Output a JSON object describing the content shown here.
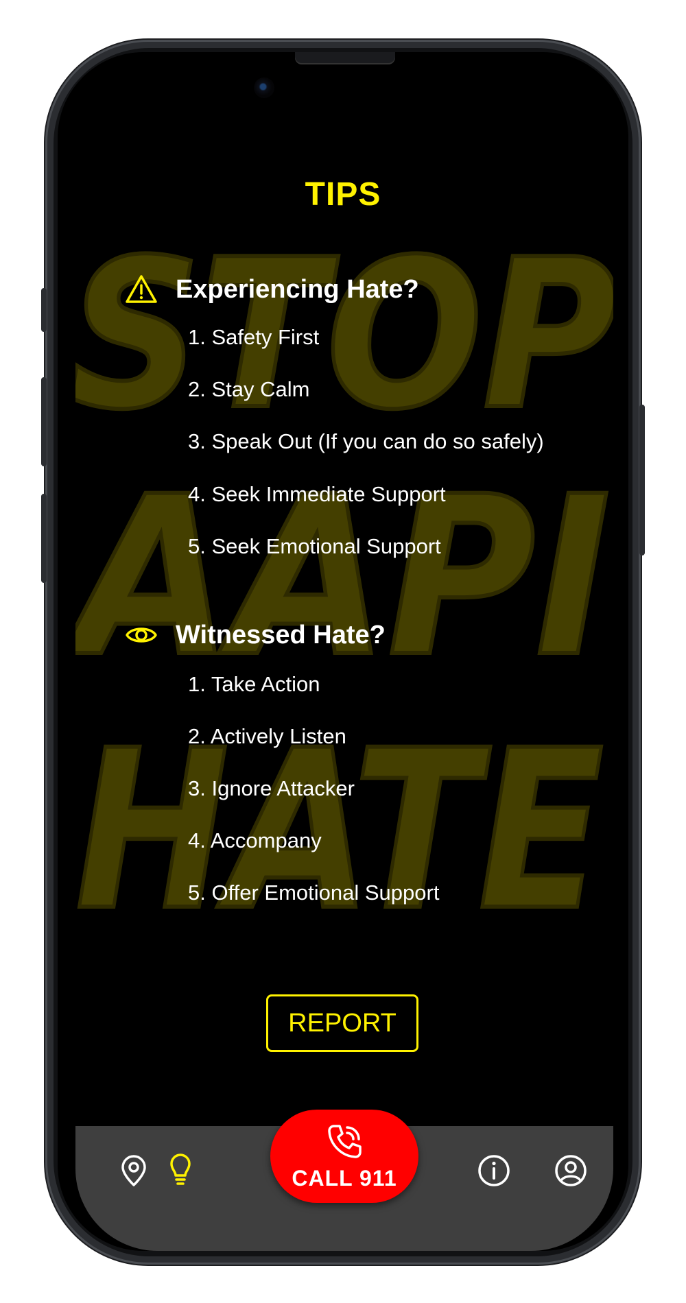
{
  "colors": {
    "accent": "#fff200",
    "call": "#ff0000",
    "navbar": "#3f3f3f",
    "background": "#000000"
  },
  "background_art": {
    "lines": [
      "STOP",
      "AAPI",
      "HATE"
    ]
  },
  "page": {
    "title": "TIPS"
  },
  "experiencing": {
    "icon": "warning-triangle-icon",
    "heading": "Experiencing Hate?",
    "tips": [
      "1. Safety First",
      "2. Stay Calm",
      "3. Speak Out (If you can do so safely)",
      "4. Seek Immediate Support",
      "5. Seek Emotional Support"
    ]
  },
  "witnessed": {
    "icon": "eye-icon",
    "heading": "Witnessed Hate?",
    "tips": [
      "1. Take Action",
      "2. Actively Listen",
      "3. Ignore Attacker",
      "4. Accompany",
      "5. Offer Emotional Support"
    ]
  },
  "report": {
    "label": "REPORT"
  },
  "navbar": {
    "items": [
      {
        "icon": "map-pin-icon",
        "active": false
      },
      {
        "icon": "lightbulb-icon",
        "active": true
      },
      {
        "icon": "info-icon",
        "active": false
      },
      {
        "icon": "profile-icon",
        "active": false
      }
    ],
    "call_label": "CALL 911"
  }
}
